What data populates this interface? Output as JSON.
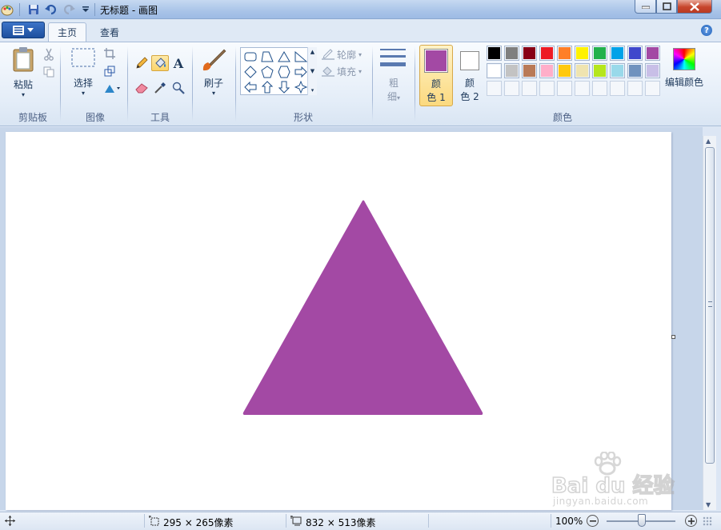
{
  "window": {
    "title": "无标题 - 画图"
  },
  "tabs": {
    "home": "主页",
    "view": "查看"
  },
  "clipboard": {
    "paste": "粘贴",
    "group": "剪贴板"
  },
  "image": {
    "select": "选择",
    "group": "图像"
  },
  "tools": {
    "group": "工具"
  },
  "brushes": {
    "label": "刷子"
  },
  "shapes": {
    "outline": "轮廓",
    "fill": "填充",
    "group": "形状"
  },
  "size": {
    "line1": "粗",
    "line2": "细"
  },
  "colors": {
    "color1_line1": "颜",
    "color1_line2": "色 1",
    "color2_line1": "颜",
    "color2_line2": "色 2",
    "edit": "编辑颜色",
    "group": "颜色",
    "color1_value": "#a349a4",
    "color2_value": "#ffffff",
    "palette_row1": [
      "#000000",
      "#7f7f7f",
      "#880015",
      "#ed1c24",
      "#ff7f27",
      "#fff200",
      "#22b14c",
      "#00a2e8",
      "#3f48cc",
      "#a349a4"
    ],
    "palette_row2": [
      "#ffffff",
      "#c3c3c3",
      "#b97a57",
      "#ffaec9",
      "#ffc90e",
      "#efe4b0",
      "#b5e61d",
      "#99d9ea",
      "#7092be",
      "#c8bfe7"
    ]
  },
  "canvas": {
    "shape": "triangle",
    "fill": "#a349a4"
  },
  "status": {
    "selection_size": "295 × 265像素",
    "canvas_size": "832 × 513像素",
    "zoom": "100%"
  },
  "watermark": {
    "brand": "Bai du 经验",
    "url": "jingyan.baidu.com"
  }
}
